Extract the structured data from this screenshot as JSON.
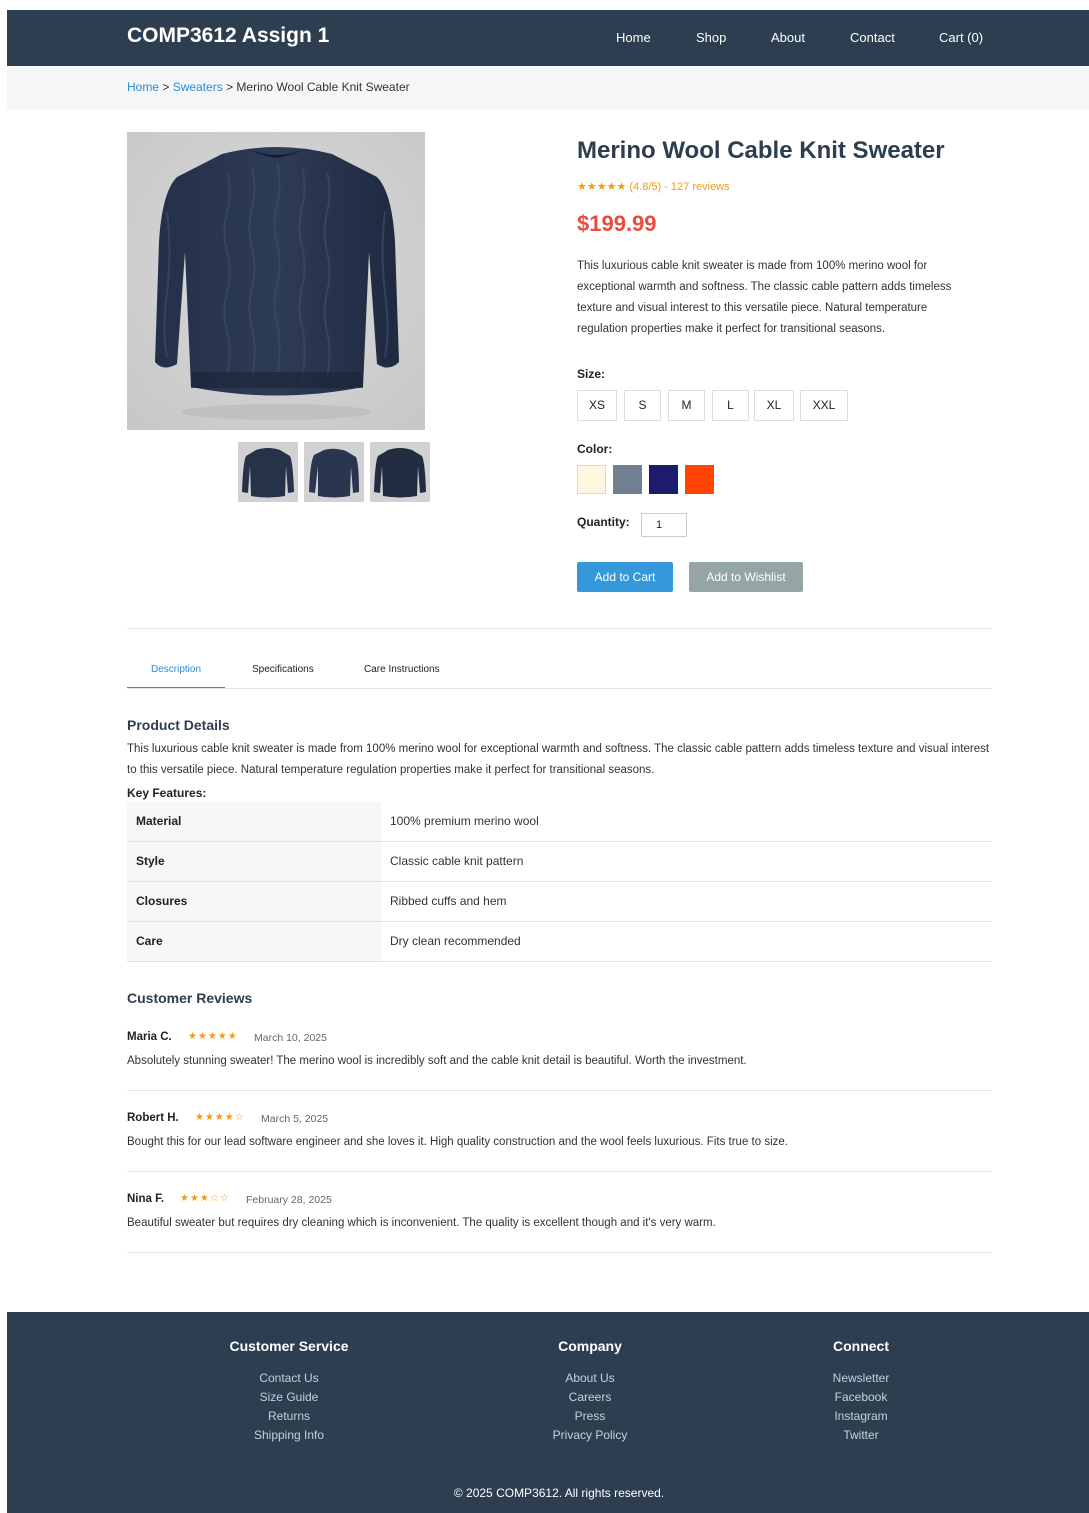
{
  "header": {
    "brand": "COMP3612 Assign 1",
    "nav": [
      "Home",
      "Shop",
      "About",
      "Contact",
      "Cart (0)"
    ]
  },
  "breadcrumb": {
    "home": "Home",
    "sep1": " > ",
    "category": "Sweaters",
    "sep2": " > ",
    "current": "Merino Wool Cable Knit Sweater"
  },
  "product": {
    "image_icon": "sweater-photo",
    "title": "Merino Wool Cable Knit Sweater",
    "rating_text": "★★★★★ (4.8/5) - 127 reviews",
    "rating_value": 4.8,
    "price": "$199.99",
    "description": "This luxurious cable knit sweater is made from 100% merino wool for exceptional warmth and softness. The classic cable pattern adds timeless texture and visual interest to this versatile piece. Natural temperature regulation properties make it perfect for transitional seasons.",
    "size_label": "Size:",
    "sizes": [
      "XS",
      "S",
      "M",
      "L",
      "XL",
      "XXL"
    ],
    "color_label": "Color:",
    "colors": [
      "#fdf6e0",
      "#708090",
      "#1c1c6e",
      "#ff4500"
    ],
    "quantity_label": "Quantity:",
    "quantity_value": "1",
    "add_to_cart": "Add to Cart",
    "add_to_wishlist": "Add to Wishlist",
    "accent_colors": {
      "primary": "#3498db",
      "secondary": "#95a5a6",
      "price": "#e74c3c",
      "star": "#f39c12",
      "dark": "#2c3e50"
    }
  },
  "tabs": {
    "items": [
      "Description",
      "Specifications",
      "Care Instructions"
    ],
    "active": "Description"
  },
  "details": {
    "heading": "Product Details",
    "text": "This luxurious cable knit sweater is made from 100% merino wool for exceptional warmth and softness. The classic cable pattern adds timeless texture and visual interest to this versatile piece. Natural temperature regulation properties make it perfect for transitional seasons.",
    "key_features_label": "Key Features:",
    "specs": [
      {
        "key": "Material",
        "value": "100% premium merino wool"
      },
      {
        "key": "Style",
        "value": "Classic cable knit pattern"
      },
      {
        "key": "Closures",
        "value": "Ribbed cuffs and hem"
      },
      {
        "key": "Care",
        "value": "Dry clean recommended"
      }
    ]
  },
  "reviews": {
    "heading": "Customer Reviews",
    "items": [
      {
        "name": "Maria C.",
        "stars": "★★★★★",
        "date": "March 10, 2025",
        "text": "Absolutely stunning sweater! The merino wool is incredibly soft and the cable knit detail is beautiful. Worth the investment."
      },
      {
        "name": "Robert H.",
        "stars": "★★★★☆",
        "date": "March 5, 2025",
        "text": "Bought this for our lead software engineer and she loves it. High quality construction and the wool feels luxurious. Fits true to size."
      },
      {
        "name": "Nina F.",
        "stars": "★★★☆☆",
        "date": "February 28, 2025",
        "text": "Beautiful sweater but requires dry cleaning which is inconvenient. The quality is excellent though and it's very warm."
      }
    ]
  },
  "footer": {
    "columns": [
      {
        "heading": "Customer Service",
        "links": [
          "Contact Us",
          "Size Guide",
          "Returns",
          "Shipping Info"
        ]
      },
      {
        "heading": "Company",
        "links": [
          "About Us",
          "Careers",
          "Press",
          "Privacy Policy"
        ]
      },
      {
        "heading": "Connect",
        "links": [
          "Newsletter",
          "Facebook",
          "Instagram",
          "Twitter"
        ]
      }
    ],
    "copyright": "© 2025 COMP3612. All rights reserved."
  }
}
